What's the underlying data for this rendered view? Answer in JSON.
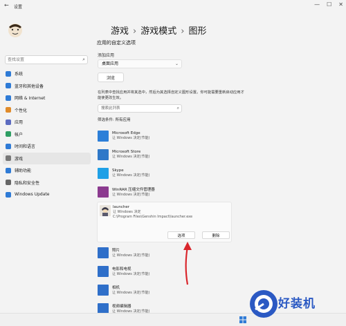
{
  "window": {
    "title": "设置",
    "back_icon": "back-arrow-icon",
    "controls": [
      "minimize-icon",
      "maximize-icon",
      "close-icon"
    ]
  },
  "sidebar": {
    "search_placeholder": "查找设置",
    "items": [
      {
        "label": "系统",
        "icon": "system-icon",
        "color": "#2f7bd6"
      },
      {
        "label": "蓝牙和其他设备",
        "icon": "bluetooth-icon",
        "color": "#2f7bd6"
      },
      {
        "label": "网络 & Internet",
        "icon": "network-icon",
        "color": "#2f7bd6"
      },
      {
        "label": "个性化",
        "icon": "brush-icon",
        "color": "#e08b2a"
      },
      {
        "label": "应用",
        "icon": "apps-icon",
        "color": "#5c6bc0"
      },
      {
        "label": "帐户",
        "icon": "account-icon",
        "color": "#2e9e63"
      },
      {
        "label": "时间和语言",
        "icon": "clock-icon",
        "color": "#2f7bd6"
      },
      {
        "label": "游戏",
        "icon": "game-icon",
        "color": "#777777",
        "active": true
      },
      {
        "label": "辅助功能",
        "icon": "accessibility-icon",
        "color": "#2f7bd6"
      },
      {
        "label": "隐私和安全性",
        "icon": "shield-icon",
        "color": "#666666"
      },
      {
        "label": "Windows Update",
        "icon": "update-icon",
        "color": "#2f7bd6"
      }
    ]
  },
  "breadcrumb": {
    "items": [
      "游戏",
      "游戏模式"
    ],
    "current": "图形",
    "separator": "›"
  },
  "main": {
    "section_title": "应用的自定义选项",
    "add_label": "添加应用",
    "dropdown_value": "桌面应用",
    "browse_label": "浏览",
    "description": "在列表中查找应用并将其选中，然后为其选择自定义图形设置。你可能需要重新启动应用才能使更改生效。",
    "list_search_placeholder": "搜索此列表",
    "filter_label": "筛选条件:",
    "filter_value": "所有应用"
  },
  "apps_top": [
    {
      "name": "Microsoft Edge",
      "sub": "让 Windows 决定(节能)",
      "icon": "edge-icon",
      "color": "#2c7fd8"
    },
    {
      "name": "Microsoft Store",
      "sub": "让 Windows 决定(节能)",
      "icon": "store-icon",
      "color": "#2f78c8"
    },
    {
      "name": "Skype",
      "sub": "让 Windows 决定(节能)",
      "icon": "skype-icon",
      "color": "#1fa0e6"
    },
    {
      "name": "WinRAR 压缩文件管理器",
      "sub": "让 Windows 决定(节能)",
      "icon": "winrar-icon",
      "color": "#8b3a8f"
    }
  ],
  "expanded_app": {
    "name": "launcher",
    "sub": "让 Windows 决定",
    "path": "C:\\Program Files\\Genshin Impact\\launcher.exe",
    "icon": "launcher-icon",
    "options_label": "选项",
    "delete_label": "删除"
  },
  "apps_bottom": [
    {
      "name": "照片",
      "sub": "让 Windows 决定(节能)",
      "icon": "photos-icon",
      "color": "#2f6fc9"
    },
    {
      "name": "电影和电视",
      "sub": "让 Windows 决定(节能)",
      "icon": "movies-icon",
      "color": "#2f6fc9"
    },
    {
      "name": "相机",
      "sub": "让 Windows 决定(节能)",
      "icon": "camera-icon",
      "color": "#2f6fc9"
    },
    {
      "name": "视频编辑器",
      "sub": "让 Windows 决定(节能)",
      "icon": "video-editor-icon",
      "color": "#2f6fc9"
    }
  ],
  "watermark": {
    "text": "好装机"
  },
  "colors": {
    "arrow": "#d9262c",
    "accent": "#2b59c3"
  }
}
